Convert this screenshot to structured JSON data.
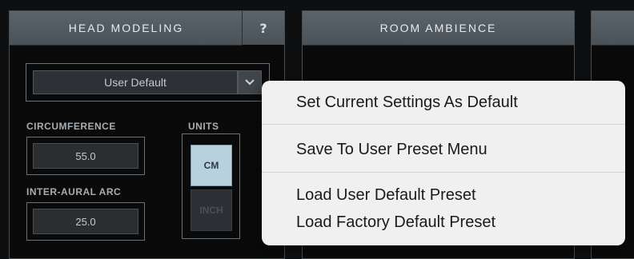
{
  "head_modeling": {
    "title": "HEAD MODELING",
    "help_label": "?",
    "preset_value": "User Default",
    "circumference_label": "CIRCUMFERENCE",
    "circumference_value": "55.0",
    "inter_aural_label": "INTER-AURAL ARC",
    "inter_aural_value": "25.0",
    "units_label": "UNITS",
    "unit_cm": "CM",
    "unit_inch": "INCH",
    "selected_unit": "CM"
  },
  "room_ambience": {
    "title": "ROOM AMBIENCE"
  },
  "context_menu": {
    "items": [
      "Set Current Settings As Default",
      "Save To User Preset Menu",
      "Load User Default Preset",
      "Load Factory Default Preset"
    ]
  },
  "colors": {
    "header_bg": "#52595f",
    "selected_unit_bg": "#b8d1df",
    "menu_bg": "#f0f0f0"
  }
}
